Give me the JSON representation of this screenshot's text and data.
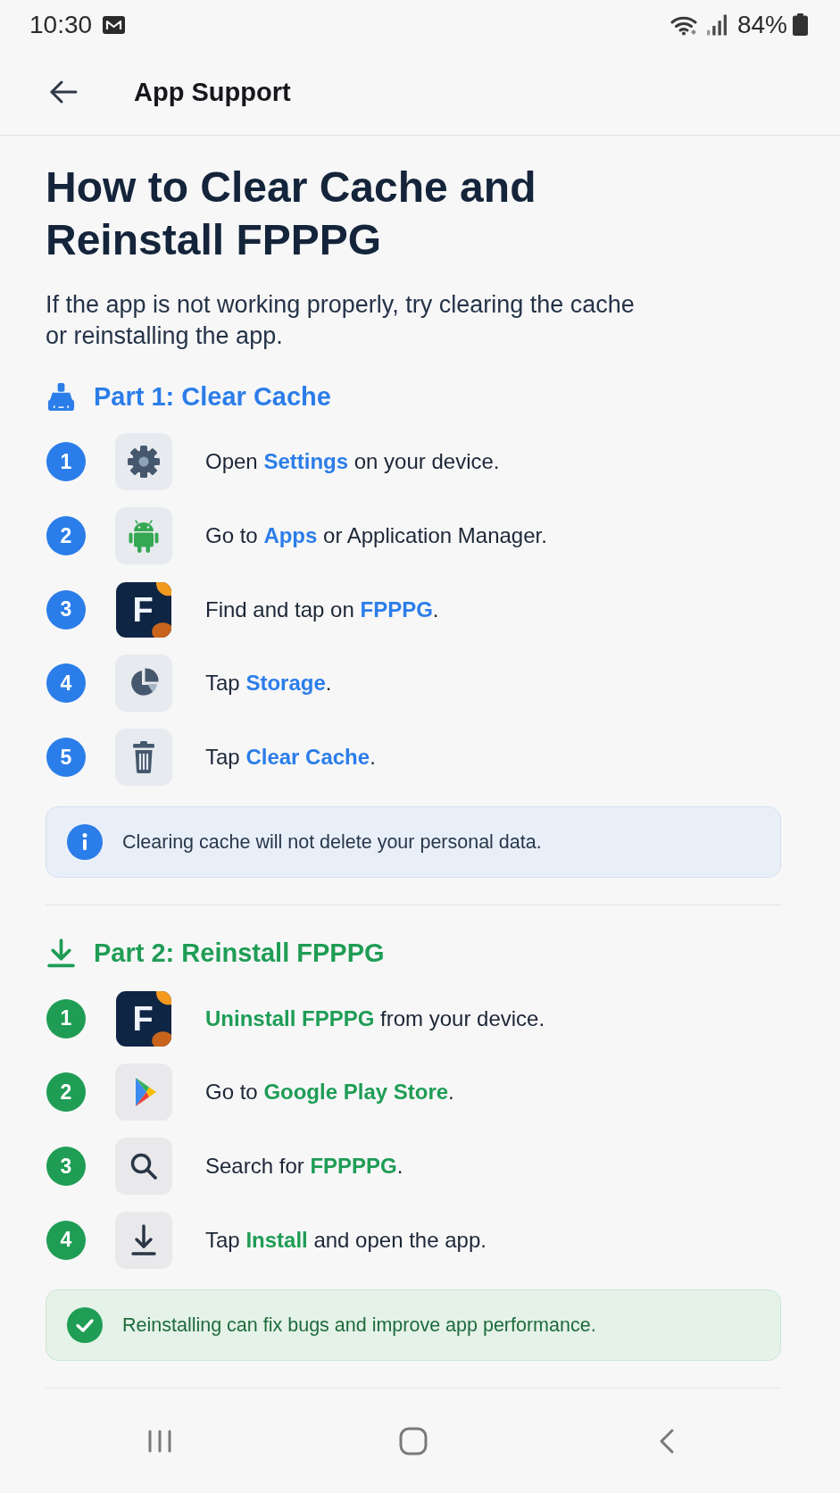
{
  "status_bar": {
    "time": "10:30",
    "battery": "84%"
  },
  "header": {
    "title": "App Support"
  },
  "title": "How to Clear Cache and Reinstall FPPPG",
  "intro": "If the app is not working properly, try clearing the cache or reinstalling the app.",
  "parts": [
    {
      "heading": "Part 1: Clear Cache",
      "color": "#2b7de9",
      "steps": [
        {
          "number": "1",
          "text": "Open **Settings** on your device."
        },
        {
          "number": "2",
          "text": "Go to **Apps** or Application Manager."
        },
        {
          "number": "3",
          "text": "Find and tap on **FPPPG**.",
          "app_letter": "F"
        },
        {
          "number": "4",
          "text": "Tap **Storage**."
        },
        {
          "number": "5",
          "text": "Tap **Clear Cache**."
        }
      ],
      "note": {
        "kind": "info",
        "text": "Clearing cache will not delete your personal data."
      }
    },
    {
      "heading": "Part 2: Reinstall FPPPG",
      "color": "#1f9d55",
      "steps": [
        {
          "number": "1",
          "text": "**Uninstall FPPPG** from your device.",
          "app_letter": "F"
        },
        {
          "number": "2",
          "text": "Go to **Google Play Store**."
        },
        {
          "number": "3",
          "text": "Search for **FPPPPG**."
        },
        {
          "number": "4",
          "text": "Tap **Install** and open the app."
        }
      ],
      "note": {
        "kind": "success",
        "text": "Reinstalling can fix bugs and improve app performance."
      }
    }
  ]
}
